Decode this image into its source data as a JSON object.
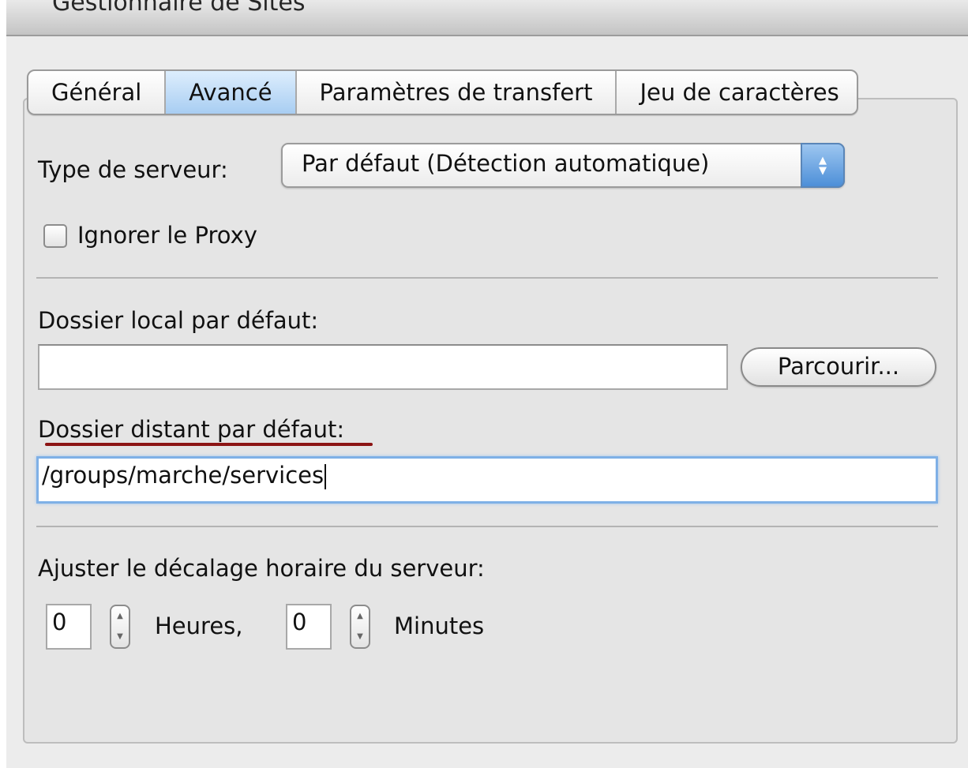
{
  "window": {
    "title": "Gestionnaire de Sites"
  },
  "tabs": [
    {
      "label": "Général",
      "active": false
    },
    {
      "label": "Avancé",
      "active": true
    },
    {
      "label": "Paramètres de transfert",
      "active": false
    },
    {
      "label": "Jeu de caractères",
      "active": false
    }
  ],
  "server_type": {
    "label": "Type de serveur:",
    "selected": "Par défaut (Détection automatique)"
  },
  "bypass_proxy": {
    "label": "Ignorer le Proxy",
    "checked": false
  },
  "local_dir": {
    "label": "Dossier local par défaut:",
    "value": "",
    "browse_label": "Parcourir..."
  },
  "remote_dir": {
    "label": "Dossier distant par défaut:",
    "value": "/groups/marche/services"
  },
  "timezone": {
    "label": "Ajuster le décalage horaire du serveur:",
    "hours_value": "0",
    "hours_label": "Heures,",
    "minutes_value": "0",
    "minutes_label": "Minutes"
  },
  "colors": {
    "annotation_underline": "#8c1414",
    "tab_active": "#a8cdf2"
  }
}
